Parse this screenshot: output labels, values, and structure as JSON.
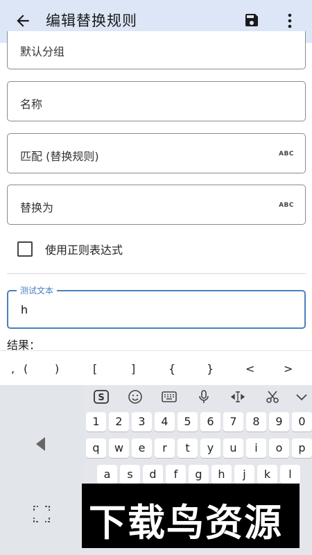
{
  "appbar": {
    "title": "编辑替换规则",
    "back_icon": "arrow-back-icon",
    "save_icon": "save-icon",
    "more_icon": "more-vert-icon"
  },
  "form": {
    "group_value": "默认分组",
    "name_placeholder": "名称",
    "match_placeholder": "匹配 (替换规则)",
    "replace_placeholder": "替换为",
    "abc_badge": "ABC",
    "regex_label": "使用正则表达式",
    "regex_checked": false,
    "test_label": "测试文本",
    "test_value": "h",
    "result_label": "结果："
  },
  "symbols": [
    ",",
    "(",
    ")",
    "[",
    "]",
    "{",
    "}",
    "<",
    ">"
  ],
  "keyboard": {
    "toolbar": [
      "sogou-logo-icon",
      "emoji-icon",
      "keyboard-icon",
      "microphone-icon",
      "cursor-move-icon",
      "scissors-icon",
      "chevron-down-icon"
    ],
    "row_numbers": [
      "1",
      "2",
      "3",
      "4",
      "5",
      "6",
      "7",
      "8",
      "9",
      "0"
    ],
    "row_top": [
      "q",
      "w",
      "e",
      "r",
      "t",
      "y",
      "u",
      "i",
      "o",
      "p"
    ],
    "row_mid": [
      "a",
      "s",
      "d",
      "f",
      "g",
      "h",
      "j",
      "k",
      "l"
    ]
  },
  "watermark": {
    "text": "下载鸟资源"
  },
  "colors": {
    "appbar_bg": "#dde6f7",
    "accent": "#4a7fc1",
    "keyboard_bg": "#e4e6eb"
  }
}
